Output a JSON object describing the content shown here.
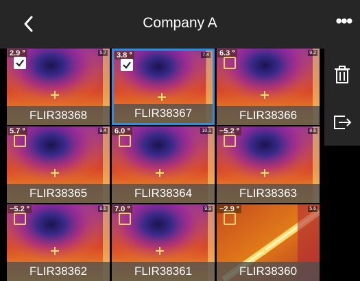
{
  "header": {
    "title": "Company A"
  },
  "images": [
    {
      "name": "FLIR38368",
      "temp": "2.9",
      "temp_max": "5.7",
      "selected": false,
      "checked": true,
      "style": "warm"
    },
    {
      "name": "FLIR38367",
      "temp": "3.8",
      "temp_max": "7.4",
      "selected": true,
      "checked": true,
      "style": "warm"
    },
    {
      "name": "FLIR38366",
      "temp": "6.3",
      "temp_max": "9.2",
      "selected": false,
      "checked": false,
      "style": "warm"
    },
    {
      "name": "FLIR38365",
      "temp": "5.7",
      "temp_max": "9.4",
      "selected": false,
      "checked": false,
      "style": "warm"
    },
    {
      "name": "FLIR38364",
      "temp": "6.0",
      "temp_max": "10.1",
      "selected": false,
      "checked": false,
      "style": "warm"
    },
    {
      "name": "FLIR38363",
      "temp": "~5.2",
      "temp_max": "8.6",
      "selected": false,
      "checked": false,
      "style": "warm"
    },
    {
      "name": "FLIR38362",
      "temp": "~5.2",
      "temp_max": "8.6",
      "selected": false,
      "checked": false,
      "style": "warm"
    },
    {
      "name": "FLIR38361",
      "temp": "7.0",
      "temp_max": "9.9",
      "selected": false,
      "checked": false,
      "style": "warm"
    },
    {
      "name": "FLIR38360",
      "temp": "~2.9",
      "temp_max": "5.6",
      "selected": false,
      "checked": false,
      "style": "pipe"
    }
  ]
}
